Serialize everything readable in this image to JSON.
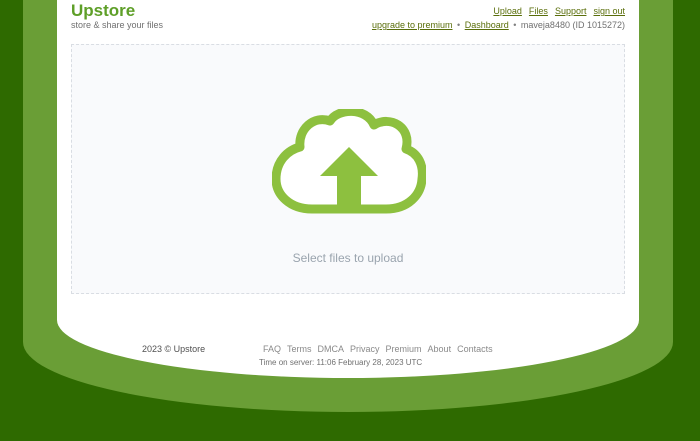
{
  "header": {
    "logo": "Upstore",
    "tagline": "store & share your files",
    "nav": [
      "Upload",
      "Files",
      "Support",
      "sign out"
    ],
    "account": {
      "upgrade_label": "upgrade to premium",
      "dashboard_label": "Dashboard",
      "separator": "•",
      "user": "maveja8480 (ID 1015272)"
    }
  },
  "dropzone": {
    "label": "Select files to upload",
    "icon": "cloud-upload-icon"
  },
  "footer": {
    "copyright": "2023 © Upstore",
    "links": [
      "FAQ",
      "Terms",
      "DMCA",
      "Privacy",
      "Premium",
      "About",
      "Contacts"
    ],
    "server_time": "Time on server: 11:06 February 28, 2023 UTC"
  },
  "colors": {
    "background": "#2e6a00",
    "frame": "#6a9e36",
    "brand": "#5e9f28",
    "cloud_icon": "#8dc03f",
    "link": "#5a6e0a"
  }
}
